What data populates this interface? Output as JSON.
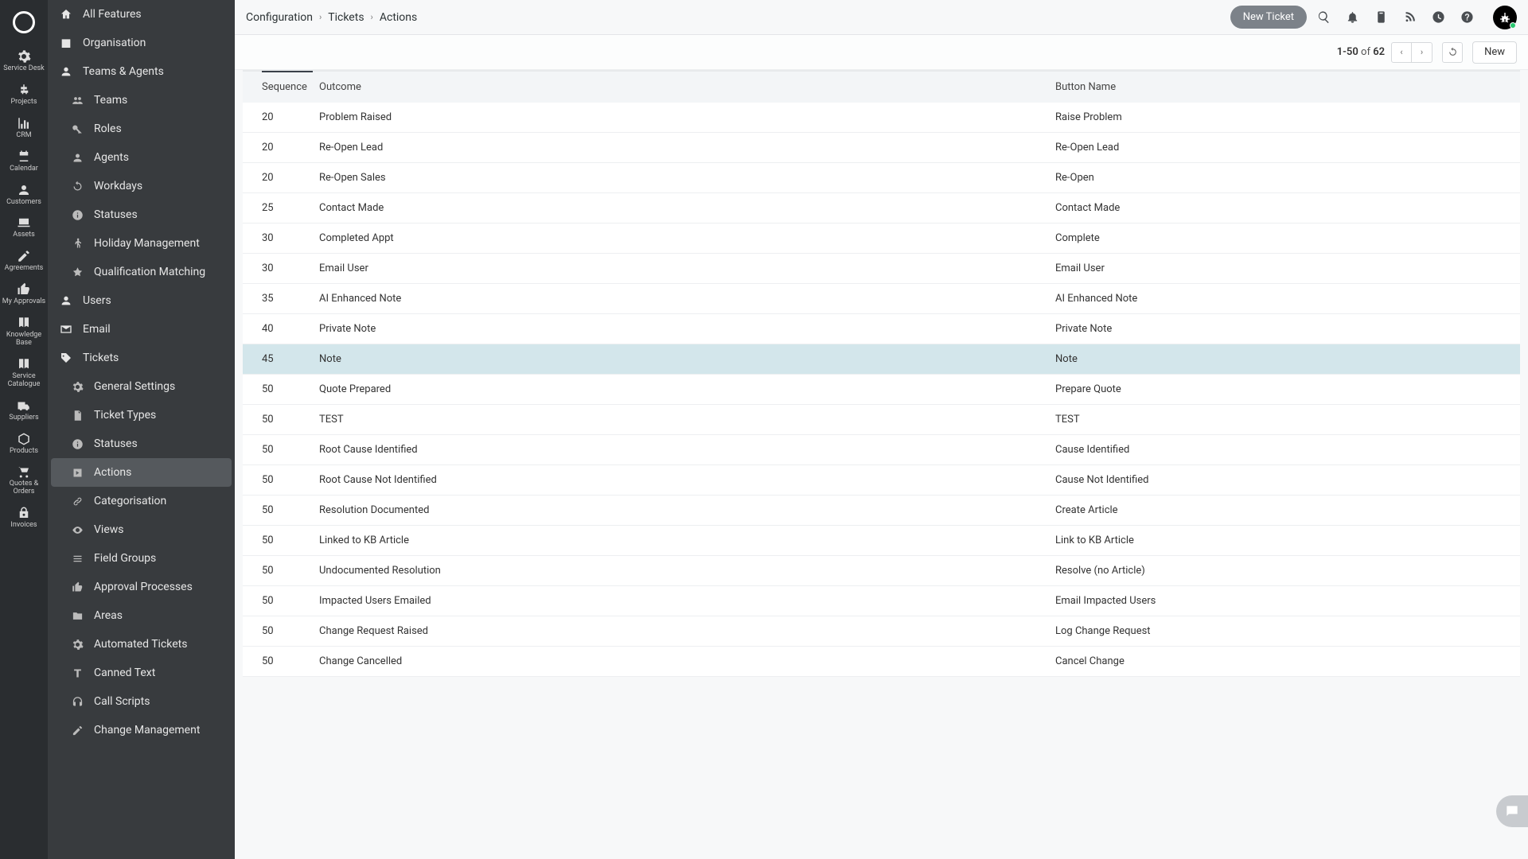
{
  "rail": [
    {
      "label": "Service Desk"
    },
    {
      "label": "Projects"
    },
    {
      "label": "CRM"
    },
    {
      "label": "Calendar"
    },
    {
      "label": "Customers"
    },
    {
      "label": "Assets"
    },
    {
      "label": "Agreements"
    },
    {
      "label": "My Approvals"
    },
    {
      "label": "Knowledge Base"
    },
    {
      "label": "Service Catalogue"
    },
    {
      "label": "Suppliers"
    },
    {
      "label": "Products"
    },
    {
      "label": "Quotes & Orders"
    },
    {
      "label": "Invoices"
    }
  ],
  "sidebar": {
    "items": [
      {
        "label": "All Features",
        "icon": "home"
      },
      {
        "label": "Organisation",
        "icon": "building"
      },
      {
        "label": "Teams & Agents",
        "icon": "person"
      },
      {
        "label": "Teams",
        "icon": "people",
        "sub": true
      },
      {
        "label": "Roles",
        "icon": "key",
        "sub": true
      },
      {
        "label": "Agents",
        "icon": "person",
        "sub": true
      },
      {
        "label": "Workdays",
        "icon": "reload",
        "sub": true
      },
      {
        "label": "Statuses",
        "icon": "info",
        "sub": true
      },
      {
        "label": "Holiday Management",
        "icon": "walk",
        "sub": true
      },
      {
        "label": "Qualification Matching",
        "icon": "badge",
        "sub": true
      },
      {
        "label": "Users",
        "icon": "person"
      },
      {
        "label": "Email",
        "icon": "mail"
      },
      {
        "label": "Tickets",
        "icon": "tag"
      },
      {
        "label": "General Settings",
        "icon": "gear",
        "sub": true
      },
      {
        "label": "Ticket Types",
        "icon": "doc",
        "sub": true
      },
      {
        "label": "Statuses",
        "icon": "info",
        "sub": true
      },
      {
        "label": "Actions",
        "icon": "play",
        "sub": true,
        "active": true
      },
      {
        "label": "Categorisation",
        "icon": "link",
        "sub": true
      },
      {
        "label": "Views",
        "icon": "eye",
        "sub": true
      },
      {
        "label": "Field Groups",
        "icon": "list",
        "sub": true
      },
      {
        "label": "Approval Processes",
        "icon": "thumb",
        "sub": true
      },
      {
        "label": "Areas",
        "icon": "folder",
        "sub": true
      },
      {
        "label": "Automated Tickets",
        "icon": "gear",
        "sub": true
      },
      {
        "label": "Canned Text",
        "icon": "text",
        "sub": true
      },
      {
        "label": "Call Scripts",
        "icon": "headset",
        "sub": true
      },
      {
        "label": "Change Management",
        "icon": "edit",
        "sub": true
      }
    ]
  },
  "breadcrumb": [
    "Configuration",
    "Tickets",
    "Actions"
  ],
  "topbar": {
    "new_ticket": "New Ticket"
  },
  "toolbar": {
    "range": "1-50",
    "of": "of",
    "total": "62",
    "new_label": "New"
  },
  "columns": {
    "seq": "Sequence",
    "outcome": "Outcome",
    "button": "Button Name"
  },
  "rows": [
    {
      "seq": "20",
      "outcome": "Problem Raised",
      "button": "Raise Problem"
    },
    {
      "seq": "20",
      "outcome": "Re-Open Lead",
      "button": "Re-Open Lead"
    },
    {
      "seq": "20",
      "outcome": "Re-Open Sales",
      "button": "Re-Open"
    },
    {
      "seq": "25",
      "outcome": "Contact Made",
      "button": "Contact Made"
    },
    {
      "seq": "30",
      "outcome": "Completed Appt",
      "button": "Complete"
    },
    {
      "seq": "30",
      "outcome": "Email User",
      "button": "Email User"
    },
    {
      "seq": "35",
      "outcome": "AI Enhanced Note",
      "button": "AI Enhanced Note"
    },
    {
      "seq": "40",
      "outcome": "Private Note",
      "button": "Private Note"
    },
    {
      "seq": "45",
      "outcome": "Note",
      "button": "Note",
      "hl": true
    },
    {
      "seq": "50",
      "outcome": "Quote Prepared",
      "button": "Prepare Quote"
    },
    {
      "seq": "50",
      "outcome": "TEST",
      "button": "TEST"
    },
    {
      "seq": "50",
      "outcome": "Root Cause Identified",
      "button": "Cause Identified"
    },
    {
      "seq": "50",
      "outcome": "Root Cause Not Identified",
      "button": "Cause Not Identified"
    },
    {
      "seq": "50",
      "outcome": "Resolution Documented",
      "button": "Create Article"
    },
    {
      "seq": "50",
      "outcome": "Linked to KB Article",
      "button": "Link to KB Article"
    },
    {
      "seq": "50",
      "outcome": "Undocumented Resolution",
      "button": "Resolve (no Article)"
    },
    {
      "seq": "50",
      "outcome": "Impacted Users Emailed",
      "button": "Email Impacted Users"
    },
    {
      "seq": "50",
      "outcome": "Change Request Raised",
      "button": "Log Change Request"
    },
    {
      "seq": "50",
      "outcome": "Change Cancelled",
      "button": "Cancel Change"
    }
  ]
}
